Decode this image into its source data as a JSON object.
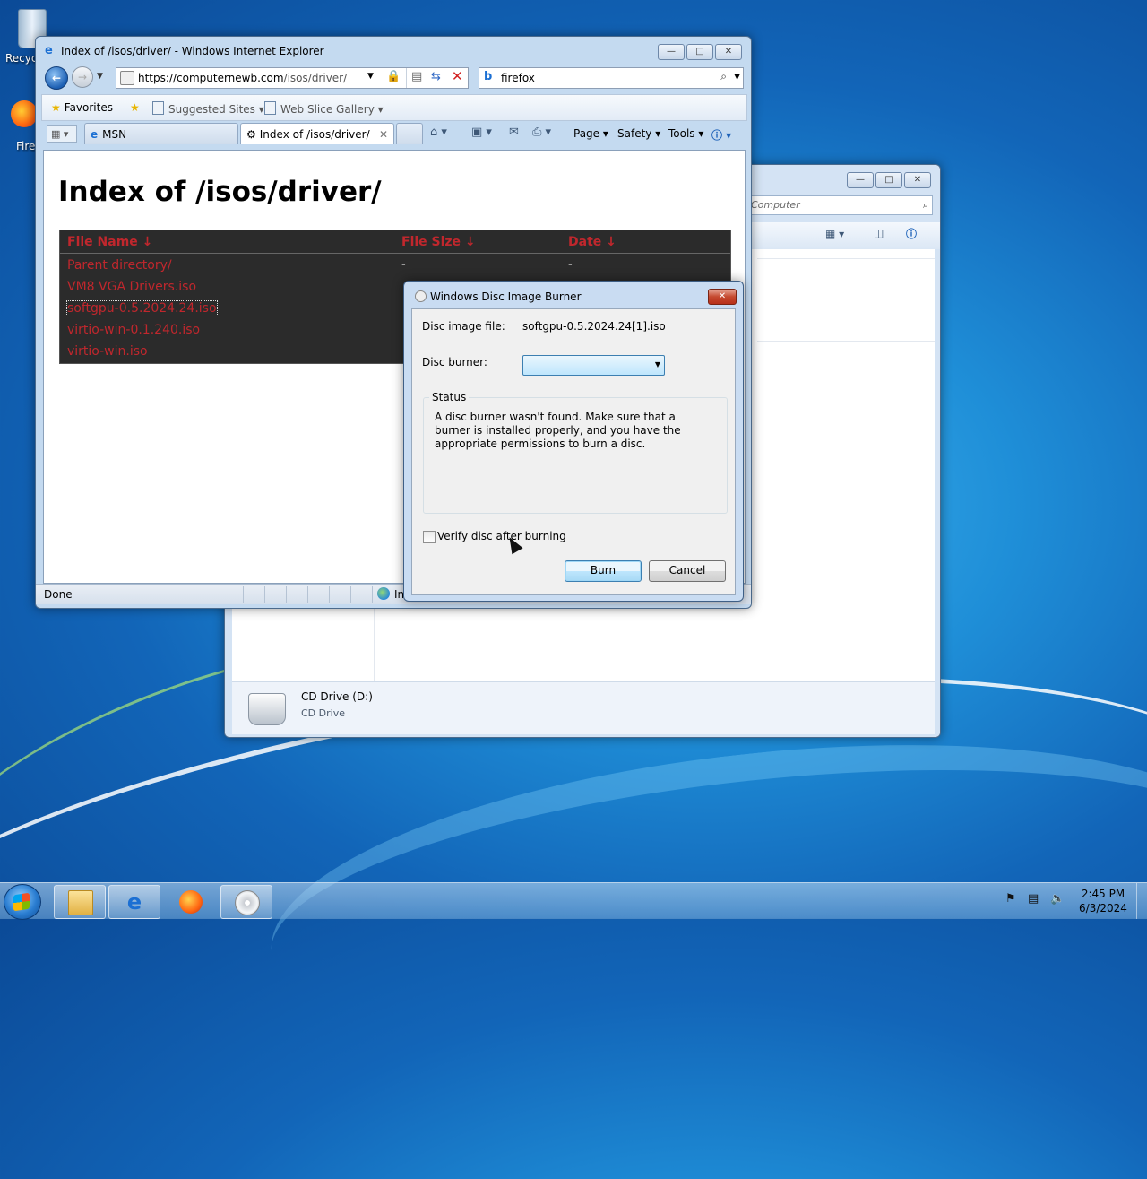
{
  "desktop": {
    "recycle_bin_label": "Recyc",
    "firefox_label": "Fire"
  },
  "explorer": {
    "search_placeholder": "Computer",
    "drive_name": "CD Drive (D:)",
    "drive_type": "CD Drive"
  },
  "ie": {
    "title": "Index of /isos/driver/ - Windows Internet Explorer",
    "address": {
      "host": "https://computernewb.com",
      "path": "/isos/driver/"
    },
    "search_text": "firefox",
    "favorites": {
      "favorites_label": "Favorites",
      "suggested_sites": "Suggested Sites",
      "web_slice_gallery": "Web Slice Gallery"
    },
    "tabs": [
      {
        "label": "MSN"
      },
      {
        "label": "Index of /isos/driver/"
      }
    ],
    "command_bar": {
      "page": "Page",
      "safety": "Safety",
      "tools": "Tools"
    },
    "page": {
      "heading": "Index of /isos/driver/",
      "columns": [
        "File Name  ↓",
        "File Size  ↓",
        "Date  ↓"
      ],
      "rows": [
        {
          "name": "Parent directory/",
          "size": "-",
          "date": "-"
        },
        {
          "name": "VM8 VGA Drivers.iso"
        },
        {
          "name": "softgpu-0.5.2024.24.iso"
        },
        {
          "name": "virtio-win-0.1.240.iso"
        },
        {
          "name": "virtio-win.iso"
        }
      ]
    },
    "status": {
      "text": "Done",
      "zone": "In"
    }
  },
  "dialog": {
    "title": "Windows Disc Image Burner",
    "disc_image_label": "Disc image file:",
    "disc_image_value": "softgpu-0.5.2024.24[1].iso",
    "disc_burner_label": "Disc burner:",
    "disc_burner_value": "",
    "status_legend": "Status",
    "status_message": "A disc burner wasn't found. Make sure that a burner is installed properly, and you have the appropriate permissions to burn a disc.",
    "verify_label": "Verify disc after burning",
    "verify_checked": false,
    "burn_label": "Burn",
    "cancel_label": "Cancel"
  },
  "taskbar": {
    "time": "2:45 PM",
    "date": "6/3/2024"
  }
}
